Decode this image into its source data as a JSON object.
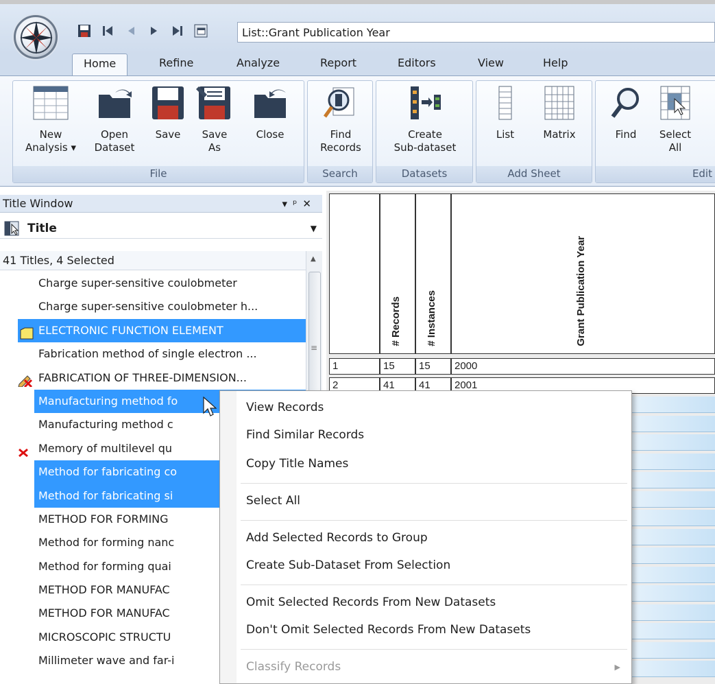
{
  "window": {
    "title": "List::Grant Publication Year"
  },
  "ribbon": {
    "tabs": [
      "Home",
      "Refine",
      "Analyze",
      "Report",
      "Editors",
      "View",
      "Help"
    ],
    "groups": {
      "file": {
        "label": "File",
        "buttons": [
          {
            "line1": "New",
            "line2": "Analysis ▾"
          },
          {
            "line1": "Open",
            "line2": "Dataset"
          },
          {
            "line1": "Save",
            "line2": ""
          },
          {
            "line1": "Save",
            "line2": "As"
          },
          {
            "line1": "Close",
            "line2": ""
          }
        ]
      },
      "search": {
        "label": "Search",
        "buttons": [
          {
            "line1": "Find",
            "line2": "Records"
          }
        ]
      },
      "datasets": {
        "label": "Datasets",
        "buttons": [
          {
            "line1": "Create",
            "line2": "Sub-dataset"
          }
        ]
      },
      "add_sheet": {
        "label": "Add Sheet",
        "buttons": [
          {
            "line1": "List",
            "line2": ""
          },
          {
            "line1": "Matrix",
            "line2": ""
          }
        ]
      },
      "edit": {
        "label": "Edit",
        "buttons": [
          {
            "line1": "Find",
            "line2": ""
          },
          {
            "line1": "Select",
            "line2": "All"
          }
        ]
      }
    }
  },
  "title_window": {
    "header": "Title Window",
    "field": "Title",
    "count": "41 Titles, 4 Selected",
    "rows": [
      {
        "text": "Charge super-sensitive coulobmeter",
        "selected": false,
        "icon": ""
      },
      {
        "text": "Charge super-sensitive coulobmeter h...",
        "selected": false,
        "icon": ""
      },
      {
        "text": "ELECTRONIC FUNCTION ELEMENT",
        "selected": true,
        "icon": "note-icon"
      },
      {
        "text": "Fabrication method of single electron ...",
        "selected": false,
        "icon": ""
      },
      {
        "text": "FABRICATION OF THREE-DIMENSION...",
        "selected": false,
        "icon": "omit-pencil-icon"
      },
      {
        "text": "Manufacturing method fo",
        "selected": true,
        "icon": ""
      },
      {
        "text": "Manufacturing method c",
        "selected": false,
        "icon": ""
      },
      {
        "text": "Memory of multilevel qu",
        "selected": false,
        "icon": "red-x-icon"
      },
      {
        "text": "Method for fabricating co",
        "selected": true,
        "icon": ""
      },
      {
        "text": "Method for fabricating si",
        "selected": true,
        "icon": ""
      },
      {
        "text": "METHOD FOR FORMING",
        "selected": false,
        "icon": ""
      },
      {
        "text": "Method for forming nanc",
        "selected": false,
        "icon": ""
      },
      {
        "text": "Method for forming quai",
        "selected": false,
        "icon": ""
      },
      {
        "text": "METHOD FOR MANUFAC",
        "selected": false,
        "icon": ""
      },
      {
        "text": "METHOD FOR MANUFAC",
        "selected": false,
        "icon": ""
      },
      {
        "text": "MICROSCOPIC STRUCTU",
        "selected": false,
        "icon": ""
      },
      {
        "text": "Millimeter wave and far-i",
        "selected": false,
        "icon": ""
      }
    ]
  },
  "matrix": {
    "headers": [
      "# Records",
      "# Instances",
      "Grant Publication Year"
    ],
    "rows": [
      {
        "n": "1",
        "records": "15",
        "instances": "15",
        "year": "2000"
      },
      {
        "n": "2",
        "records": "41",
        "instances": "41",
        "year": "2001"
      }
    ]
  },
  "context_menu": {
    "items": [
      {
        "label": "View Records",
        "disabled": false
      },
      {
        "label": "Find Similar Records",
        "disabled": false
      },
      {
        "label": "Copy Title Names",
        "disabled": false
      },
      {
        "label": "Select All",
        "disabled": false
      },
      {
        "label": "Add Selected Records to Group",
        "disabled": false
      },
      {
        "label": "Create Sub-Dataset From Selection",
        "disabled": false
      },
      {
        "label": "Omit Selected Records From New Datasets",
        "disabled": false
      },
      {
        "label": "Don't Omit Selected Records From New Datasets",
        "disabled": false
      },
      {
        "label": "Classify Records",
        "disabled": true
      }
    ]
  },
  "colors": {
    "selection": "#3399ff",
    "ribbon": "#dfe9f5",
    "matrix_fill": "#c8e2f6"
  }
}
